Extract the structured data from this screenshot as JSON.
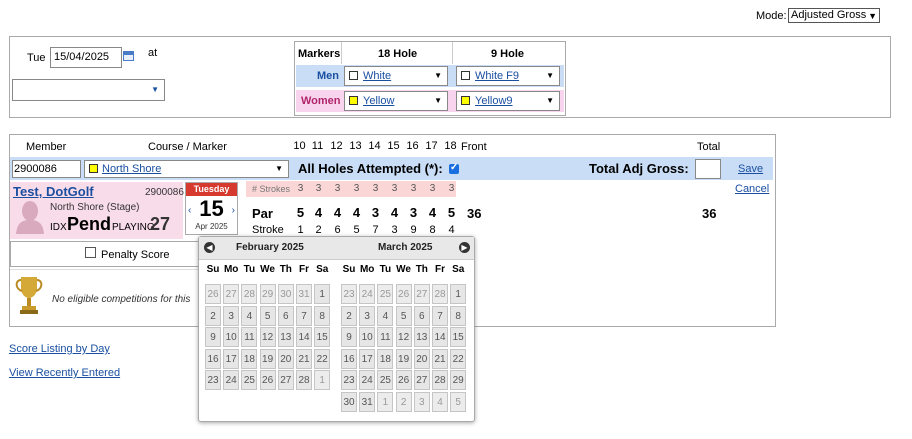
{
  "mode": {
    "label": "Mode:",
    "value": "Adjusted Gross"
  },
  "entry": {
    "day_of_week": "Tue",
    "date": "15/04/2025",
    "at_label": "at",
    "tee_value": ""
  },
  "markers": {
    "heading": "Markers",
    "col18": "18 Hole",
    "col9": "9 Hole",
    "men_label": "Men",
    "men_18": "White",
    "men_9": "White F9",
    "women_label": "Women",
    "women_18": "Yellow",
    "women_9": "Yellow9"
  },
  "columns": {
    "member": "Member",
    "course_marker": "Course / Marker",
    "front": "Front",
    "total": "Total",
    "holes": [
      "10",
      "11",
      "12",
      "13",
      "14",
      "15",
      "16",
      "17",
      "18"
    ]
  },
  "row": {
    "member_id": "2900086",
    "course": "North Shore",
    "all_holes_label": "All Holes Attempted (*):",
    "total_adj_label": "Total Adj Gross:",
    "total_adj_value": "",
    "save": "Save",
    "cancel": "Cancel"
  },
  "player": {
    "name": "Test, DotGolf",
    "id": "2900086",
    "club": "North Shore (Stage)",
    "idx_label": "IDX",
    "idx_value": "Pend",
    "playing_label": "PLAYING",
    "playing_value": "27"
  },
  "date_tile": {
    "dow": "Tuesday",
    "day": "15",
    "month_year": "Apr 2025"
  },
  "scorecard": {
    "strokes_label": "# Strokes",
    "strokes": [
      "3",
      "3",
      "3",
      "3",
      "3",
      "3",
      "3",
      "3",
      "3"
    ],
    "par_label": "Par",
    "par": [
      "5",
      "4",
      "4",
      "4",
      "3",
      "4",
      "3",
      "4",
      "5"
    ],
    "par_front": "36",
    "par_total": "36",
    "stroke_label": "Stroke",
    "stroke_index": [
      "1",
      "2",
      "6",
      "5",
      "7",
      "3",
      "9",
      "8",
      "4"
    ]
  },
  "penalty_label": "Penalty Score",
  "competitions_text": "No eligible competitions for this",
  "calendar": {
    "left_title": "February 2025",
    "right_title": "March 2025",
    "dow": [
      "Su",
      "Mo",
      "Tu",
      "We",
      "Th",
      "Fr",
      "Sa"
    ],
    "feb": [
      [
        "26",
        "27",
        "28",
        "29",
        "30",
        "31",
        "1"
      ],
      [
        "2",
        "3",
        "4",
        "5",
        "6",
        "7",
        "8"
      ],
      [
        "9",
        "10",
        "11",
        "12",
        "13",
        "14",
        "15"
      ],
      [
        "16",
        "17",
        "18",
        "19",
        "20",
        "21",
        "22"
      ],
      [
        "23",
        "24",
        "25",
        "26",
        "27",
        "28",
        "1"
      ]
    ],
    "mar": [
      [
        "23",
        "24",
        "25",
        "26",
        "27",
        "28",
        "1"
      ],
      [
        "2",
        "3",
        "4",
        "5",
        "6",
        "7",
        "8"
      ],
      [
        "9",
        "10",
        "11",
        "12",
        "13",
        "14",
        "15"
      ],
      [
        "16",
        "17",
        "18",
        "19",
        "20",
        "21",
        "22"
      ],
      [
        "23",
        "24",
        "25",
        "26",
        "27",
        "28",
        "29"
      ],
      [
        "30",
        "31",
        "1",
        "2",
        "3",
        "4",
        "5"
      ]
    ]
  },
  "links": {
    "score_listing": "Score Listing by Day",
    "recent": "View Recently Entered"
  }
}
